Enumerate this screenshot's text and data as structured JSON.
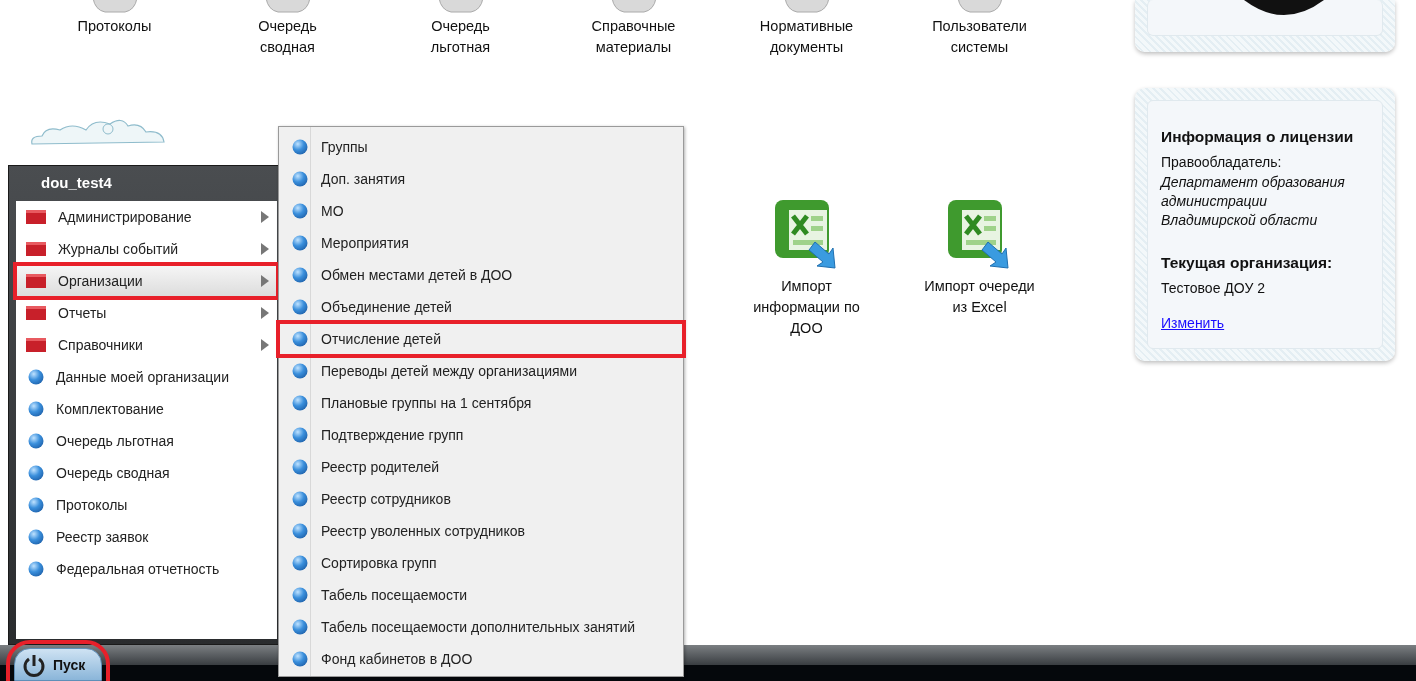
{
  "desktop": {
    "icons": [
      {
        "label": "Протоколы"
      },
      {
        "label": "Очередь\nсводная"
      },
      {
        "label": "Очередь\nльготная"
      },
      {
        "label": "Справочные\nматериалы"
      },
      {
        "label": "Нормативные\nдокументы"
      },
      {
        "label": "Пользователи\nсистемы"
      }
    ],
    "import_icons": [
      {
        "label": "Импорт\nинформации по\nДОО"
      },
      {
        "label": "Импорт очереди\nиз Excel"
      }
    ]
  },
  "info_panel": {
    "title": "Информация о лицензии",
    "owner_label": "Правообладатель:",
    "owner": "Департамент образования\nадминистрации\nВладимирской области",
    "org_title": "Текущая организация:",
    "org": "Тестовое ДОУ 2",
    "change_link": "Изменить"
  },
  "start_menu": {
    "user": "dou_test4",
    "items": [
      {
        "kind": "folder",
        "label": "Администрирование",
        "selected": false,
        "highlighted": false
      },
      {
        "kind": "folder",
        "label": "Журналы событий",
        "selected": false,
        "highlighted": false
      },
      {
        "kind": "folder",
        "label": "Организации",
        "selected": true,
        "highlighted": true
      },
      {
        "kind": "folder",
        "label": "Отчеты",
        "selected": false,
        "highlighted": false
      },
      {
        "kind": "folder",
        "label": "Справочники",
        "selected": false,
        "highlighted": false
      },
      {
        "kind": "item",
        "label": "Данные моей организации",
        "selected": false,
        "highlighted": false
      },
      {
        "kind": "item",
        "label": "Комплектование",
        "selected": false,
        "highlighted": false
      },
      {
        "kind": "item",
        "label": "Очередь льготная",
        "selected": false,
        "highlighted": false
      },
      {
        "kind": "item",
        "label": "Очередь сводная",
        "selected": false,
        "highlighted": false
      },
      {
        "kind": "item",
        "label": "Протоколы",
        "selected": false,
        "highlighted": false
      },
      {
        "kind": "item",
        "label": "Реестр заявок",
        "selected": false,
        "highlighted": false
      },
      {
        "kind": "item",
        "label": "Федеральная отчетность",
        "selected": false,
        "highlighted": false
      }
    ]
  },
  "submenu": {
    "items": [
      {
        "label": "Группы",
        "highlighted": false
      },
      {
        "label": "Доп. занятия",
        "highlighted": false
      },
      {
        "label": "МО",
        "highlighted": false
      },
      {
        "label": "Мероприятия",
        "highlighted": false
      },
      {
        "label": "Обмен местами детей в ДОО",
        "highlighted": false
      },
      {
        "label": "Объединение детей",
        "highlighted": false
      },
      {
        "label": "Отчисление детей",
        "highlighted": true
      },
      {
        "label": "Переводы детей между организациями",
        "highlighted": false
      },
      {
        "label": "Плановые группы на 1 сентября",
        "highlighted": false
      },
      {
        "label": "Подтверждение групп",
        "highlighted": false
      },
      {
        "label": "Реестр родителей",
        "highlighted": false
      },
      {
        "label": "Реестр сотрудников",
        "highlighted": false
      },
      {
        "label": "Реестр уволенных сотрудников",
        "highlighted": false
      },
      {
        "label": "Сортировка групп",
        "highlighted": false
      },
      {
        "label": "Табель посещаемости",
        "highlighted": false
      },
      {
        "label": "Табель посещаемости дополнительных занятий",
        "highlighted": false
      },
      {
        "label": "Фонд кабинетов в ДОО",
        "highlighted": false
      }
    ]
  },
  "taskbar": {
    "start_button": {
      "label": "Пуск",
      "highlighted": true
    }
  }
}
